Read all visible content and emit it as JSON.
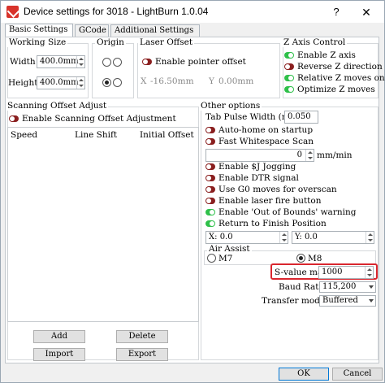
{
  "window": {
    "title": "Device settings for 3018 - LightBurn 1.0.04",
    "help_label": "?",
    "close_label": "✕"
  },
  "tabs": [
    {
      "label": "Basic Settings",
      "active": true
    },
    {
      "label": "GCode",
      "active": false
    },
    {
      "label": "Additional Settings",
      "active": false
    }
  ],
  "working_size": {
    "title": "Working Size",
    "width_label": "Width",
    "width_value": "400.0mm",
    "height_label": "Height",
    "height_value": "400.0mm"
  },
  "origin": {
    "title": "Origin"
  },
  "laser_offset": {
    "title": "Laser Offset",
    "enable_label": "Enable pointer offset",
    "x_label": "X",
    "x_value": "-16.50mm",
    "y_label": "Y",
    "y_value": "0.00mm"
  },
  "z_axis": {
    "title": "Z Axis Control",
    "items": [
      {
        "label": "Enable Z axis",
        "on": true
      },
      {
        "label": "Reverse Z direction",
        "on": false
      },
      {
        "label": "Relative Z moves only",
        "on": true
      },
      {
        "label": "Optimize Z moves",
        "on": true
      }
    ]
  },
  "scanning": {
    "title": "Scanning Offset Adjust",
    "enable_label": "Enable Scanning Offset Adjustment",
    "columns": [
      "Speed",
      "Line Shift",
      "Initial Offset"
    ],
    "add_label": "Add",
    "delete_label": "Delete",
    "import_label": "Import",
    "export_label": "Export"
  },
  "other": {
    "title": "Other options",
    "tab_pulse_label": "Tab Pulse Width (mm)",
    "tab_pulse_value": "0.050",
    "items": [
      {
        "label": "Auto-home on startup",
        "on": false
      },
      {
        "label": "Fast Whitespace Scan",
        "on": false
      }
    ],
    "speed_value": "0",
    "speed_unit": "mm/min",
    "items2": [
      {
        "label": "Enable $J Jogging",
        "on": false
      },
      {
        "label": "Enable DTR signal",
        "on": false
      },
      {
        "label": "Use G0 moves for overscan",
        "on": false
      },
      {
        "label": "Enable laser fire button",
        "on": false
      },
      {
        "label": "Enable 'Out of Bounds' warning",
        "on": true
      },
      {
        "label": "Return to Finish Position",
        "on": true
      }
    ],
    "x_label": "X:",
    "x_value": "0.0",
    "y_label": "Y:",
    "y_value": "0.0"
  },
  "air_assist": {
    "title": "Air Assist",
    "m7_label": "M7",
    "m8_label": "M8"
  },
  "svalue": {
    "label": "S-value max",
    "value": "1000"
  },
  "baud": {
    "label": "Baud Rate",
    "value": "115,200"
  },
  "transfer": {
    "label": "Transfer mode",
    "value": "Buffered"
  },
  "footer": {
    "ok_label": "OK",
    "cancel_label": "Cancel"
  },
  "colors": {
    "toggle_on": "#2fc04a",
    "toggle_off": "#8a1f1f",
    "highlight": "#d9262e"
  }
}
